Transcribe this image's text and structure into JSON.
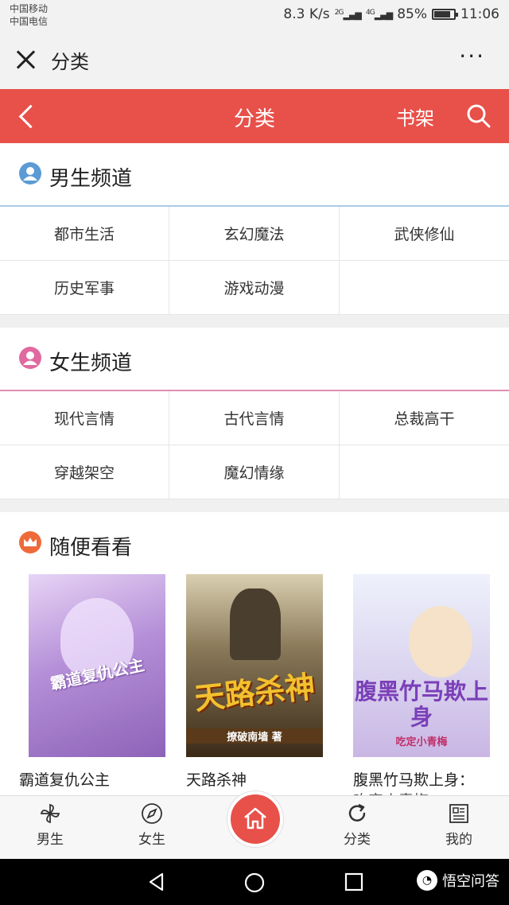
{
  "status_bar": {
    "carrier1": "中国移动",
    "carrier2": "中国电信",
    "speed": "8.3 K/s",
    "net1": "2G",
    "net2": "4G",
    "battery": "85%",
    "time": "11:06"
  },
  "titlebar": {
    "title": "分类",
    "more": "···"
  },
  "header": {
    "title": "分类",
    "shelf": "书架"
  },
  "male": {
    "title": "男生频道",
    "items": [
      "都市生活",
      "玄幻魔法",
      "武侠修仙",
      "历史军事",
      "游戏动漫",
      ""
    ]
  },
  "female": {
    "title": "女生频道",
    "items": [
      "现代言情",
      "古代言情",
      "总裁高干",
      "穿越架空",
      "魔幻情缘",
      ""
    ]
  },
  "random": {
    "title": "随便看看",
    "books": [
      {
        "title": "霸道复仇公主",
        "cover_text": "霸道复仇公主"
      },
      {
        "title": "天路杀神",
        "cover_text": "天路杀神",
        "cover_author": "撩破南墙 著"
      },
      {
        "title": "腹黑竹马欺上身：",
        "title_line2": "吃定小青梅",
        "cover_text": "腹黑竹马欺上身",
        "cover_sub": "吃定小青梅"
      }
    ]
  },
  "bottom_nav": {
    "male": "男生",
    "female": "女生",
    "category": "分类",
    "mine": "我的"
  },
  "watermark": "悟空问答",
  "colors": {
    "accent": "#e8504a",
    "male_icon": "#5b9bd5",
    "female_icon": "#e06aa0",
    "random_icon": "#ef6a3a"
  }
}
